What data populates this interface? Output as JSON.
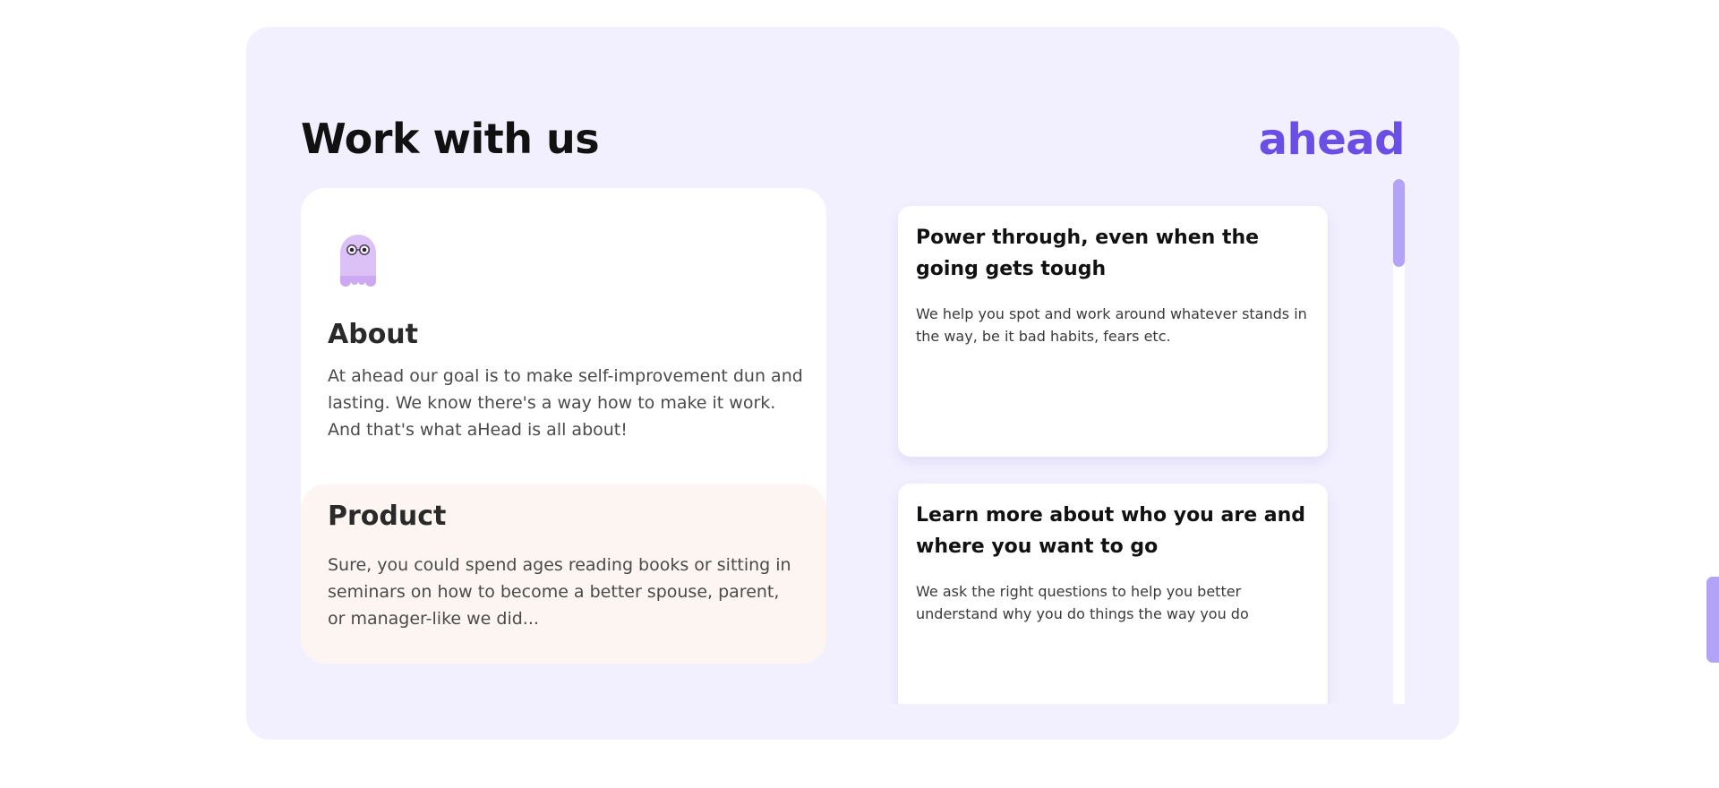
{
  "header": {
    "title": "Work with us",
    "logo": "ahead"
  },
  "about": {
    "icon": "ghost-mascot-icon",
    "title": "About",
    "text": "At ahead our goal is to make self-improvement dun and lasting. We know there's a way how to make it work. And that's what aHead is all about!"
  },
  "product": {
    "title": "Product",
    "text": "Sure, you could spend ages reading books or sitting in seminars on how to become a better spouse, parent, or manager-like we did..."
  },
  "features": [
    {
      "title": "Power through, even when the going gets tough",
      "text": "We help you spot and work around whatever stands in the way, be it bad habits, fears etc."
    },
    {
      "title": "Learn more about who you are and where you want to go",
      "text": "We ask the right questions to help you better understand why you do things the way you do"
    }
  ],
  "colors": {
    "accent": "#6b4ee6",
    "panel_bg": "#f2f0ff",
    "product_bg": "#fdf5f1",
    "scrollbar": "#b2a3f7"
  }
}
